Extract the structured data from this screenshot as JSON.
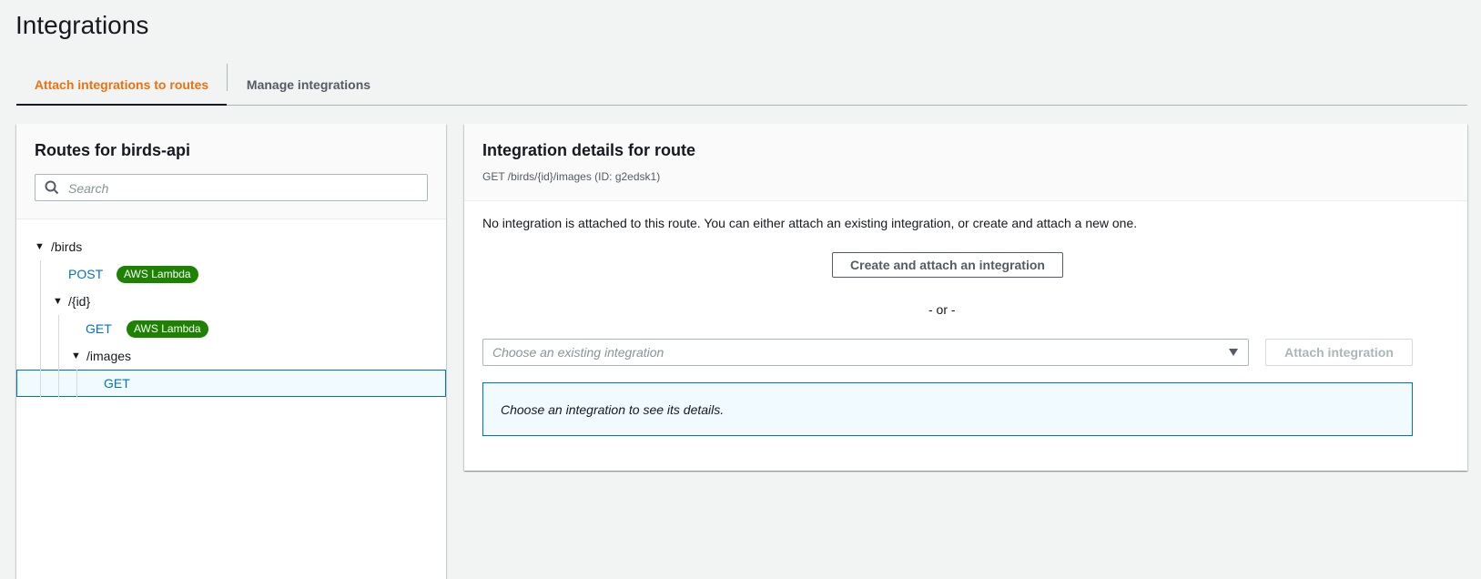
{
  "page": {
    "title": "Integrations"
  },
  "tabs": [
    {
      "label": "Attach integrations to routes",
      "active": true
    },
    {
      "label": "Manage integrations",
      "active": false
    }
  ],
  "routes_panel": {
    "title": "Routes for birds-api",
    "search": {
      "placeholder": "Search",
      "value": ""
    },
    "tree": [
      {
        "type": "resource",
        "label": "/birds",
        "expanded": true
      },
      {
        "type": "method",
        "label": "POST",
        "badge": "AWS Lambda"
      },
      {
        "type": "resource",
        "label": "/{id}",
        "expanded": true
      },
      {
        "type": "method",
        "label": "GET",
        "badge": "AWS Lambda"
      },
      {
        "type": "resource",
        "label": "/images",
        "expanded": true
      },
      {
        "type": "method",
        "label": "GET",
        "badge": "",
        "selected": true
      }
    ]
  },
  "details_panel": {
    "title": "Integration details for route",
    "subtitle": "GET /birds/{id}/images (ID: g2edsk1)",
    "message": "No integration is attached to this route. You can either attach an existing integration, or create and attach a new one.",
    "create_button": "Create and attach an integration",
    "or_text": "- or -",
    "select_placeholder": "Choose an existing integration",
    "attach_button": "Attach integration",
    "info_text": "Choose an integration to see its details."
  },
  "colors": {
    "accent": "#ec7211",
    "link": "#0073bb",
    "badge": "#1d8102"
  },
  "icons": [
    "search-icon",
    "caret-down-icon"
  ]
}
